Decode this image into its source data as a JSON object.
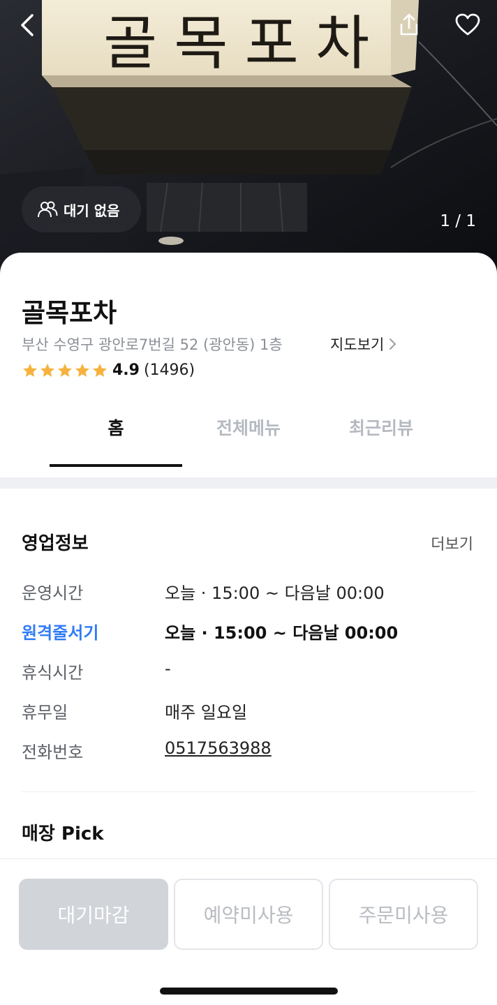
{
  "hero": {
    "sign_text": "골목포차",
    "wait_status": "대기 없음",
    "pager": "1 / 1"
  },
  "icons": {
    "back": "chevron-left-icon",
    "share": "share-icon",
    "like": "heart-icon",
    "people": "people-icon",
    "chevron_right": "chevron-right-icon",
    "star": "star-icon"
  },
  "store": {
    "name": "골목포차",
    "address": "부산 수영구 광안로7번길 52 (광안동) 1층",
    "map_link": "지도보기",
    "rating": "4.9",
    "review_count": "(1496)",
    "stars": 5
  },
  "tabs": [
    {
      "label": "홈",
      "active": true
    },
    {
      "label": "전체메뉴",
      "active": false
    },
    {
      "label": "최근리뷰",
      "active": false
    }
  ],
  "business_info": {
    "title": "영업정보",
    "more": "더보기",
    "rows": [
      {
        "label": "운영시간",
        "value": "오늘 · 15:00 ~ 다음날 00:00"
      },
      {
        "label": "원격줄서기",
        "value": "오늘 · 15:00 ~ 다음날 00:00"
      },
      {
        "label": "휴식시간",
        "value": "-"
      },
      {
        "label": "휴무일",
        "value": "매주 일요일"
      },
      {
        "label": "전화번호",
        "value": "0517563988"
      }
    ]
  },
  "store_pick": {
    "title": "매장 Pick"
  },
  "actions": {
    "waitlist": "대기마감",
    "reservation": "예약미사용",
    "order": "주문미사용"
  },
  "colors": {
    "accent_blue": "#2f7bf5",
    "star": "#f6b23c",
    "disabled_button": "#d1d4d9",
    "tab_inactive": "#b5b9c0"
  }
}
